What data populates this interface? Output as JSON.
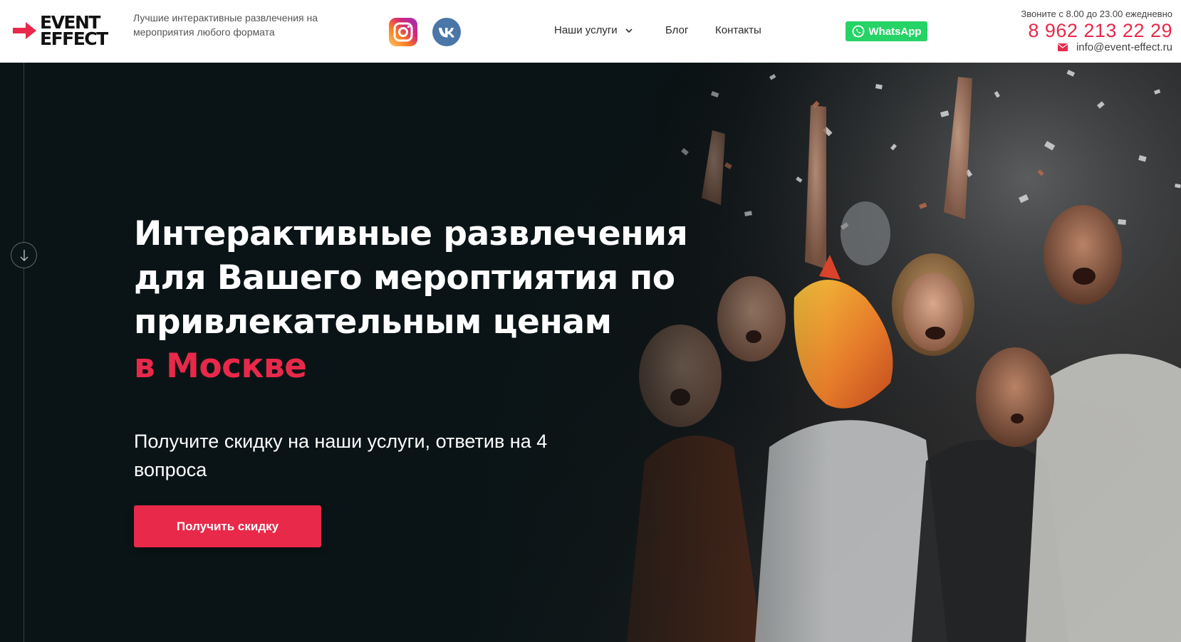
{
  "brand": {
    "logo_line1": "EVENT",
    "logo_line2": "EFFECT",
    "tagline": "Лучшие интерактивные развлечения на мероприятия любого формата",
    "accent_color": "#e8294a"
  },
  "social": [
    {
      "name": "instagram",
      "icon": "instagram-icon"
    },
    {
      "name": "vk",
      "icon": "vk-icon"
    }
  ],
  "nav": {
    "services": "Наши услуги",
    "blog": "Блог",
    "contacts": "Контакты"
  },
  "whatsapp": {
    "label": "WhatsApp",
    "color": "#25d366"
  },
  "contacts": {
    "hours": "Звоните с 8.00 до 23.00 ежедневно",
    "phone": "8 962 213 22 29",
    "email": "info@event-effect.ru"
  },
  "hero": {
    "title_line1": "Интерактивные развлечения",
    "title_line2": "для Вашего мероптиятия по",
    "title_line3": "привлекательным ценам",
    "title_accent": "в Москве",
    "subtitle": "Получите скидку на наши услуги, ответив на 4 вопроса",
    "cta_label": "Получить скидку"
  }
}
